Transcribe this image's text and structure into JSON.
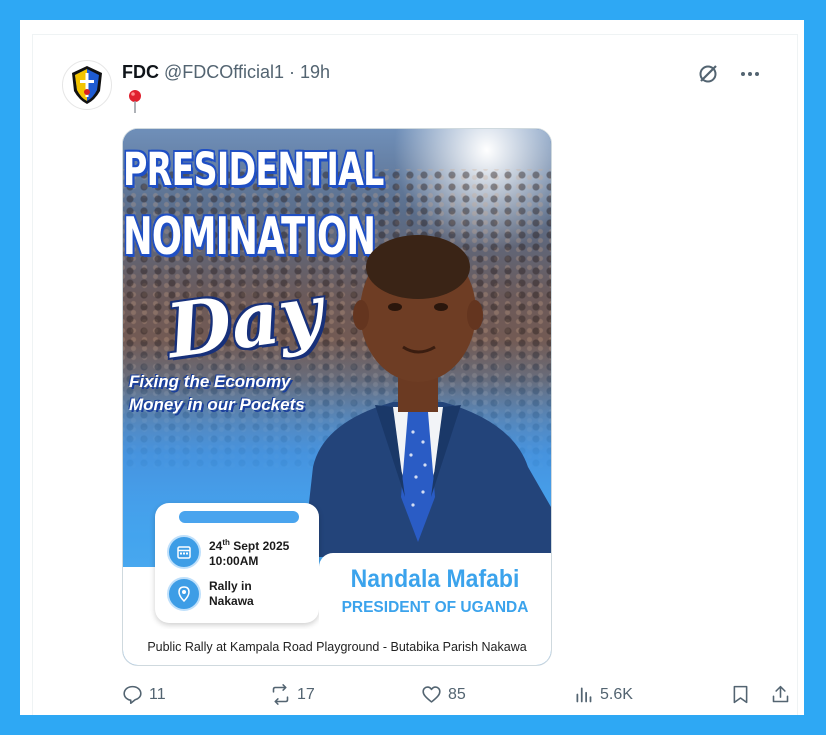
{
  "post": {
    "author_name": "FDC",
    "handle": "@FDCOfficial1",
    "separator": "·",
    "time": "19h",
    "emoji": "📍"
  },
  "media": {
    "headline_line1": "PRESIDENTIAL",
    "headline_line2": "NOMINATION",
    "script_word": "Day",
    "slogan_line1": "Fixing the Economy",
    "slogan_line2": "Money in our Pockets",
    "date_day": "24",
    "date_suffix": "th",
    "date_rest": " Sept 2025",
    "time": "10:00AM",
    "venue_line1": "Rally in",
    "venue_line2": "Nakawa",
    "candidate_name": "Nandala Mafabi",
    "candidate_title": "PRESIDENT OF UGANDA",
    "caption": "Public Rally at Kampala Road Playground - Butabika Parish Nakawa"
  },
  "actions": {
    "replies": "11",
    "reposts": "17",
    "likes": "85",
    "views": "5.6K"
  },
  "colors": {
    "frame": "#2ea8f4",
    "accent": "#3ba3ec",
    "muted": "#536471"
  }
}
